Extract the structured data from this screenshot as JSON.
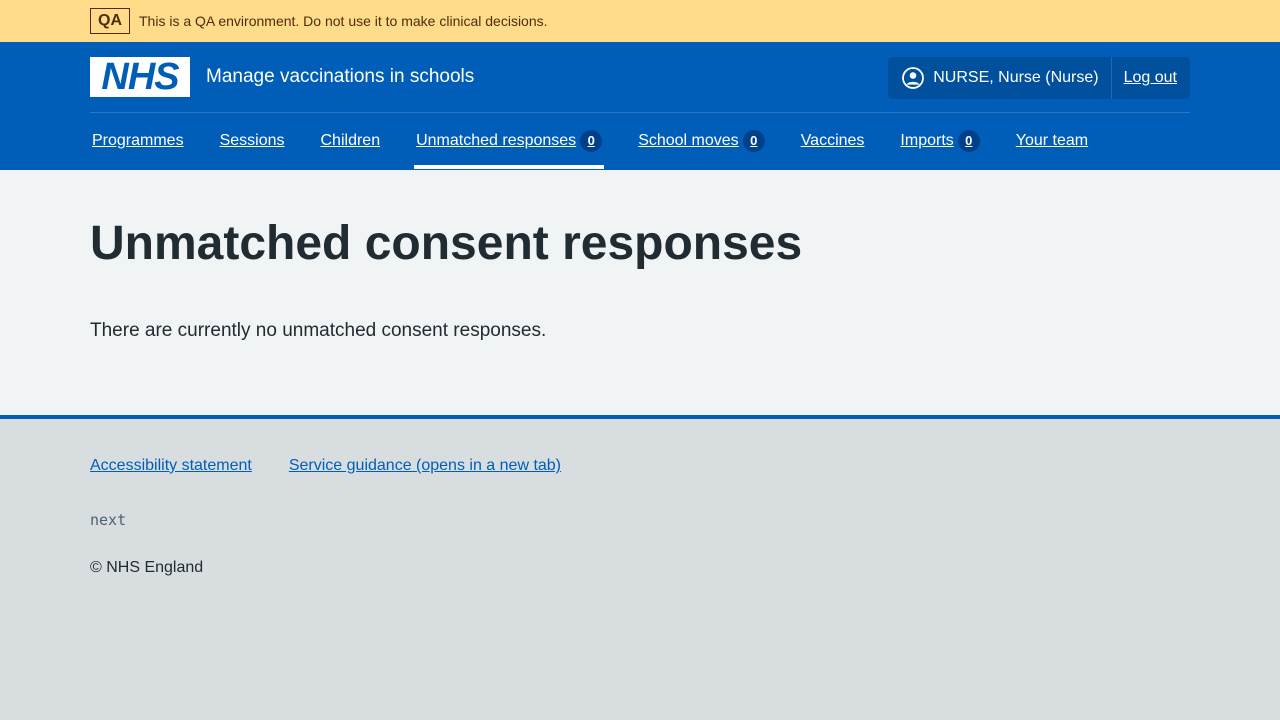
{
  "env_banner": {
    "tag": "QA",
    "text": "This is a QA environment. Do not use it to make clinical decisions.",
    "bg_color": "#ffdb8a"
  },
  "header": {
    "logo_text": "NHS",
    "service_name": "Manage vaccinations in schools",
    "account": {
      "icon": "user-circle-icon",
      "user_label": "NURSE, Nurse (Nurse)",
      "logout_label": "Log out"
    },
    "nav": [
      {
        "label": "Programmes"
      },
      {
        "label": "Sessions"
      },
      {
        "label": "Children"
      },
      {
        "label": "Unmatched responses",
        "count": "0",
        "active": true
      },
      {
        "label": "School moves",
        "count": "0"
      },
      {
        "label": "Vaccines"
      },
      {
        "label": "Imports",
        "count": "0"
      },
      {
        "label": "Your team"
      }
    ],
    "brand_color": "#005eb8"
  },
  "main": {
    "title": "Unmatched consent responses",
    "message": "There are currently no unmatched consent responses."
  },
  "footer": {
    "links": [
      {
        "label": "Accessibility statement"
      },
      {
        "label": "Service guidance (opens in a new tab)"
      }
    ],
    "version": "next",
    "copyright": "© NHS England"
  }
}
